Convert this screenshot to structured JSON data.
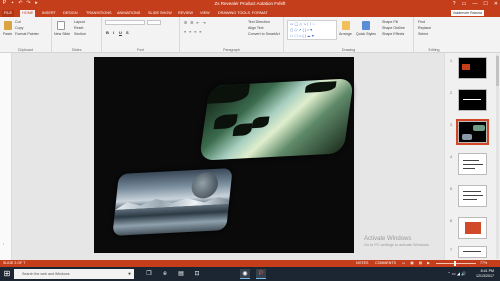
{
  "app": {
    "title": "Zs Revealer Product Aotation Fvfeft",
    "accent": "#c43e1c",
    "window_controls": {
      "help": "?",
      "restore": "▭",
      "minimize": "—",
      "maximize": "☐",
      "close": "✕"
    },
    "qat_icons": [
      "save-icon",
      "undo-icon",
      "redo-icon",
      "present-icon"
    ]
  },
  "tabs": {
    "file": "FILE",
    "items": [
      "HOME",
      "INSERT",
      "DESIGN",
      "TRANSITIONS",
      "ANIMATIONS",
      "SLIDE SHOW",
      "REVIEW",
      "VIEW",
      "DRAWING TOOLS",
      "FORMAT"
    ],
    "account": "Valdemofe Ralonia"
  },
  "ribbon": {
    "clipboard": {
      "paste": "Paste",
      "cut": "Cut",
      "copy": "Copy",
      "format_painter": "Format Painter",
      "label": "Clipboard"
    },
    "slides": {
      "new_slide": "New Slide",
      "layout": "Layout",
      "reset": "Reset",
      "section": "Section",
      "label": "Slides"
    },
    "font": {
      "b": "B",
      "i": "I",
      "u": "U",
      "s": "S",
      "label": "Font"
    },
    "paragraph": {
      "text_direction": "Text Direction",
      "align_text": "Align Text",
      "convert": "Convert to SmartArt",
      "label": "Paragraph"
    },
    "drawing": {
      "arrange": "Arrange",
      "quick_styles": "Quick Styles",
      "shape_fill": "Shape Fill",
      "shape_outline": "Shape Outline",
      "shape_effects": "Shape Effects",
      "label": "Drawing"
    },
    "editing": {
      "find": "Find",
      "replace": "Replace",
      "select": "Select",
      "label": "Editing"
    }
  },
  "thumbnails": [
    "1",
    "2",
    "3",
    "4",
    "5",
    "6",
    "7"
  ],
  "watermark": {
    "line1": "Activate Windows",
    "line2": "Go to PC settings to activate Windows."
  },
  "status": {
    "slide": "SLIDE 3 OF 7",
    "notes": "NOTES",
    "comments": "COMMENTS",
    "zoom": "77%"
  },
  "taskbar": {
    "search_placeholder": "Search the web and Windows",
    "time": "8:41 PM",
    "date": "12/13/2017",
    "icons": [
      "task-view-icon",
      "edge-icon",
      "file-explorer-icon",
      "store-icon",
      "chrome-icon",
      "powerpoint-icon"
    ]
  }
}
